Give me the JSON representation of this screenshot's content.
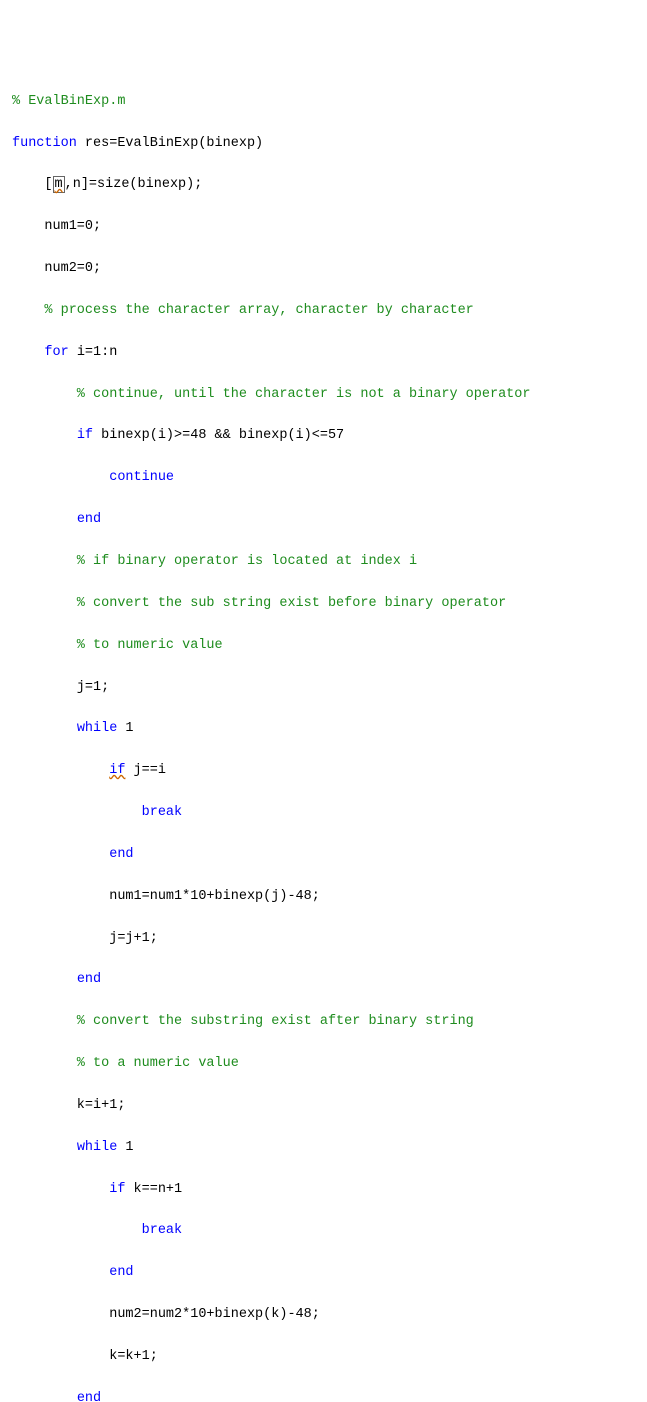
{
  "code": {
    "l1_comment": "% EvalBinExp.m",
    "l2_kw": "function",
    "l2_rest": " res=EvalBinExp(binexp)",
    "l3_a": "    [",
    "l3_m": "m",
    "l3_b": ",n]=size(binexp);",
    "l4": "    num1=0;",
    "l5": "    num2=0;",
    "l6_comment": "    % process the character array, character by character",
    "l7_pre": "    ",
    "l7_kw": "for",
    "l7_rest": " i=1:n",
    "l8_comment": "        % continue, until the character is not a binary operator",
    "l9_pre": "        ",
    "l9_kw": "if",
    "l9_rest": " binexp(i)>=48 && binexp(i)<=57",
    "l10_pre": "            ",
    "l10_kw": "continue",
    "l11_pre": "        ",
    "l11_kw": "end",
    "l12_comment": "        % if binary operator is located at index i",
    "l13_comment": "        % convert the sub string exist before binary operator",
    "l14_comment": "        % to numeric value",
    "l15": "        j=1;",
    "l16_pre": "        ",
    "l16_kw": "while",
    "l16_rest": " 1",
    "l17_pre": "            ",
    "l17_kw": "if",
    "l17_rest": " j==i",
    "l18_pre": "                ",
    "l18_kw": "break",
    "l19_pre": "            ",
    "l19_kw": "end",
    "l20": "            num1=num1*10+binexp(j)-48;",
    "l21": "            j=j+1;",
    "l22_pre": "        ",
    "l22_kw": "end",
    "l23_comment": "        % convert the substring exist after binary string",
    "l24_comment": "        % to a numeric value",
    "l25": "        k=i+1;",
    "l26_pre": "        ",
    "l26_kw": "while",
    "l26_rest": " 1",
    "l27_pre": "            ",
    "l27_kw": "if",
    "l27_rest": " k==n+1",
    "l28_pre": "                ",
    "l28_kw": "break",
    "l29_pre": "            ",
    "l29_kw": "end",
    "l30": "            num2=num2*10+binexp(k)-48;",
    "l31": "            k=k+1;",
    "l32_pre": "        ",
    "l32_kw": "end"
  }
}
